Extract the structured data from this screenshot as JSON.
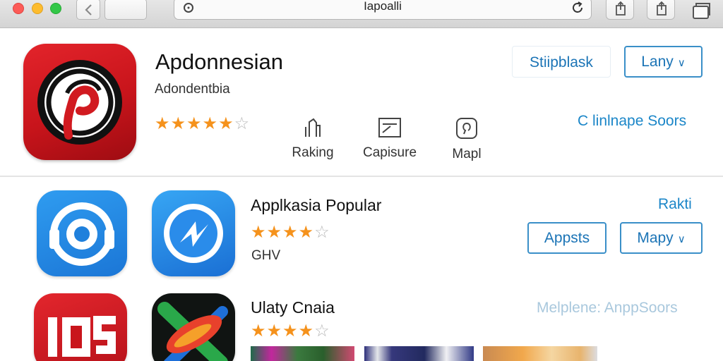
{
  "browser": {
    "url": "Iapoalli"
  },
  "featured": {
    "title": "Apdonnesian",
    "subtitle": "Adondentbia",
    "rating": 4.5,
    "stats": [
      {
        "label": "Raking",
        "icon": "ranking-icon"
      },
      {
        "label": "Capisure",
        "icon": "capture-icon"
      },
      {
        "label": "Mapl",
        "icon": "map-icon"
      }
    ],
    "buttons": {
      "stripblask": "Stiipblask",
      "lany": "Lany"
    },
    "link": "C linlnape Soors"
  },
  "section": {
    "title_row1": "Applkasia Popular",
    "row1_rating": 4.5,
    "row1_sub": "GHV",
    "link_right": "Rakti",
    "btn_appsts": "Appsts",
    "btn_mapy": "Mapy",
    "title_row2": "Ulaty Cnaia",
    "row2_rating": 4.5,
    "help_link": "Melplene: AnppSoors"
  },
  "colors": {
    "accent": "#1b74b6",
    "star": "#f5921c",
    "featured_icon": "#d3161d"
  }
}
